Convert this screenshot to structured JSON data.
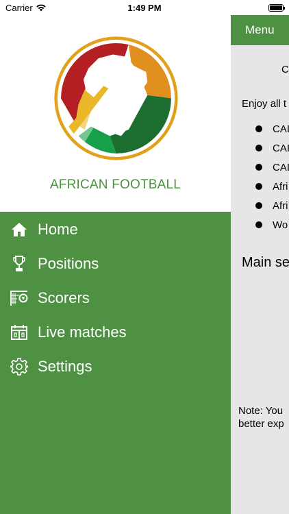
{
  "status": {
    "carrier": "Carrier",
    "time": "1:49 PM"
  },
  "drawer": {
    "brand": "AFRICAN FOOTBALL",
    "items": [
      {
        "label": "Home",
        "icon": "home-icon"
      },
      {
        "label": "Positions",
        "icon": "trophy-icon"
      },
      {
        "label": "Scorers",
        "icon": "goal-icon"
      },
      {
        "label": "Live matches",
        "icon": "scoreboard-icon"
      },
      {
        "label": "Settings",
        "icon": "gear-icon"
      }
    ]
  },
  "main": {
    "header_label": "Menu",
    "line1": "C",
    "line2": "Enjoy all t",
    "list": [
      "CAI",
      "CAI",
      "CAI",
      "Afri",
      "Afri",
      "Wo"
    ],
    "section_title": "Main se",
    "note_line1": "Note: You",
    "note_line2": "better exp"
  },
  "colors": {
    "green": "#4f9142",
    "drawer_bg": "#4f9142",
    "main_bg": "#e6e6e6"
  }
}
